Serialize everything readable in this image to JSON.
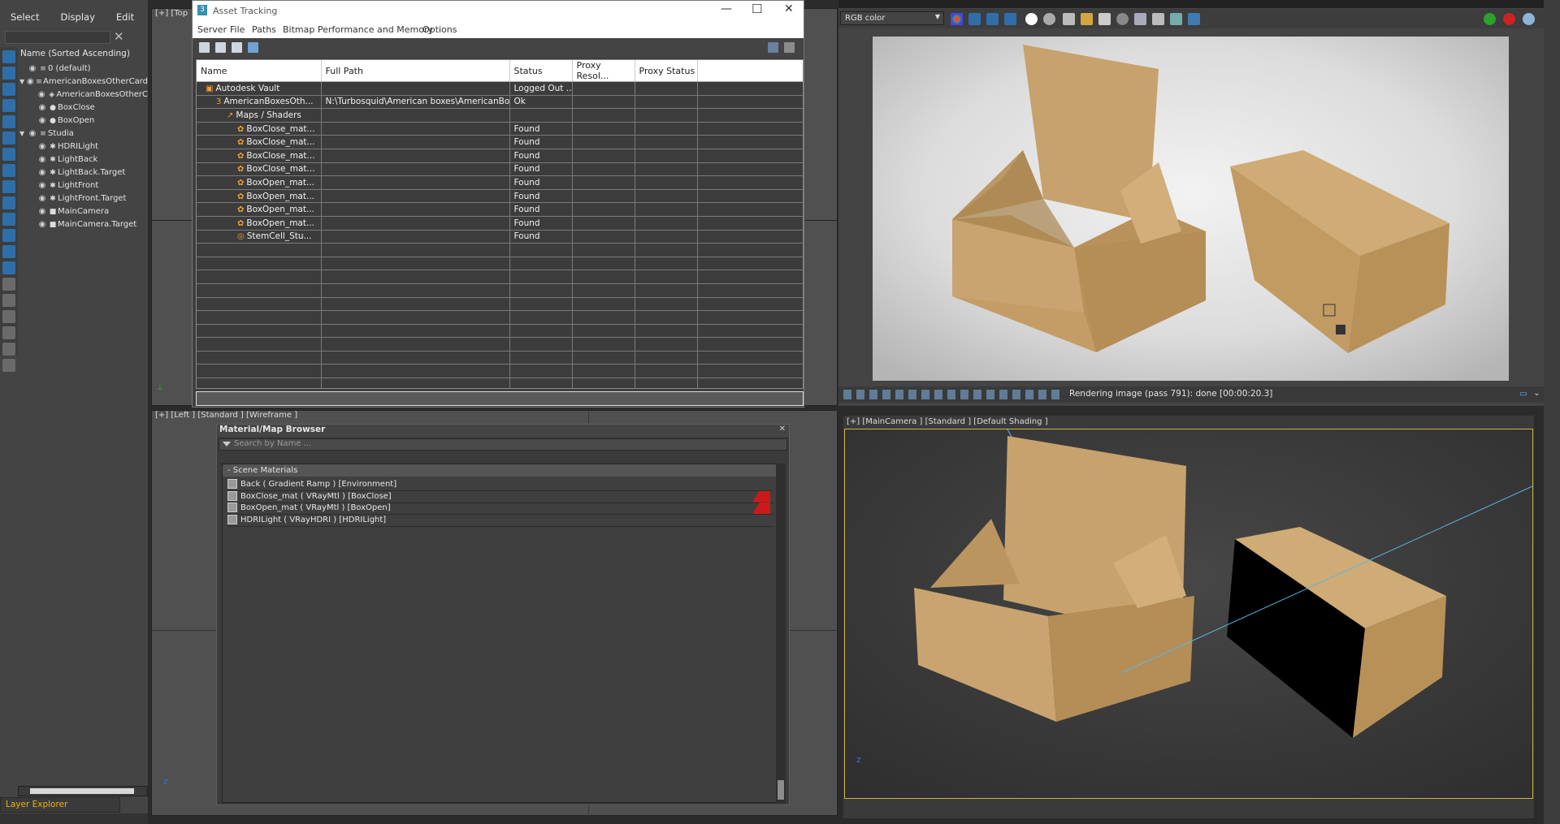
{
  "explorer": {
    "menu": [
      "Select",
      "Display",
      "Edit"
    ],
    "header": "Name (Sorted Ascending)",
    "rows": [
      {
        "indent": 0,
        "twisty": "",
        "label": "0 (default)",
        "icon": "layer"
      },
      {
        "indent": 0,
        "twisty": "▼",
        "label": "AmericanBoxesOtherCard",
        "icon": "layer"
      },
      {
        "indent": 1,
        "twisty": "",
        "label": "AmericanBoxesOtherC",
        "icon": "container"
      },
      {
        "indent": 1,
        "twisty": "",
        "label": "BoxClose",
        "icon": "object"
      },
      {
        "indent": 1,
        "twisty": "",
        "label": "BoxOpen",
        "icon": "object"
      },
      {
        "indent": 0,
        "twisty": "▼",
        "label": "Studia",
        "icon": "layer"
      },
      {
        "indent": 1,
        "twisty": "",
        "label": "HDRILight",
        "icon": "light"
      },
      {
        "indent": 1,
        "twisty": "",
        "label": "LightBack",
        "icon": "light"
      },
      {
        "indent": 1,
        "twisty": "",
        "label": "LightBack.Target",
        "icon": "light"
      },
      {
        "indent": 1,
        "twisty": "",
        "label": "LightFront",
        "icon": "light"
      },
      {
        "indent": 1,
        "twisty": "",
        "label": "LightFront.Target",
        "icon": "light"
      },
      {
        "indent": 1,
        "twisty": "",
        "label": "MainCamera",
        "icon": "camera"
      },
      {
        "indent": 1,
        "twisty": "",
        "label": "MainCamera.Target",
        "icon": "camera"
      }
    ],
    "layer_explorer": "Layer Explorer"
  },
  "viewports": {
    "top_label": "[+] [Top",
    "left_label": "[+] [Left ] [Standard ] [Wireframe ]",
    "cam_label": "[+] [MainCamera ] [Standard ] [Default Shading ]"
  },
  "asset_tracking": {
    "title": "Asset Tracking",
    "menu": [
      "Server",
      "File",
      "Paths",
      "Bitmap Performance and Memory",
      "Options"
    ],
    "columns": [
      "Name",
      "Full Path",
      "Status",
      "Proxy Resol...",
      "Proxy Status"
    ],
    "rows": [
      {
        "indent": 1,
        "name": "Autodesk Vault",
        "path": "",
        "status": "Logged Out ...",
        "icon": "vault"
      },
      {
        "indent": 2,
        "name": "AmericanBoxesOth...",
        "path": "N:\\Turbosquid\\American boxes\\AmericanBo...",
        "status": "Ok",
        "icon": "max"
      },
      {
        "indent": 3,
        "name": "Maps / Shaders",
        "path": "",
        "status": "",
        "icon": "maps"
      },
      {
        "indent": 4,
        "name": "BoxClose_mat...",
        "path": "",
        "status": "Found",
        "icon": "mat"
      },
      {
        "indent": 4,
        "name": "BoxClose_mat...",
        "path": "",
        "status": "Found",
        "icon": "mat"
      },
      {
        "indent": 4,
        "name": "BoxClose_mat...",
        "path": "",
        "status": "Found",
        "icon": "mat"
      },
      {
        "indent": 4,
        "name": "BoxClose_mat...",
        "path": "",
        "status": "Found",
        "icon": "mat"
      },
      {
        "indent": 4,
        "name": "BoxOpen_mat...",
        "path": "",
        "status": "Found",
        "icon": "mat"
      },
      {
        "indent": 4,
        "name": "BoxOpen_mat...",
        "path": "",
        "status": "Found",
        "icon": "mat"
      },
      {
        "indent": 4,
        "name": "BoxOpen_mat...",
        "path": "",
        "status": "Found",
        "icon": "mat"
      },
      {
        "indent": 4,
        "name": "BoxOpen_mat...",
        "path": "",
        "status": "Found",
        "icon": "mat"
      },
      {
        "indent": 4,
        "name": "StemCell_Stu...",
        "path": "",
        "status": "Found",
        "icon": "stem"
      }
    ],
    "empty_rows": 11
  },
  "material_browser": {
    "title": "Material/Map Browser",
    "search_placeholder": "Search by Name ...",
    "category": "- Scene Materials",
    "items": [
      {
        "label": "Back  ( Gradient Ramp )  [Environment]",
        "flag": false
      },
      {
        "label": "BoxClose_mat  ( VRayMtl )  [BoxClose]",
        "flag": true
      },
      {
        "label": "BoxOpen_mat  ( VRayMtl )  [BoxOpen]",
        "flag": true
      },
      {
        "label": "HDRILight  ( VRayHDRI )  [HDRILight]",
        "flag": false
      }
    ]
  },
  "render_frame": {
    "channel": "RGB color",
    "status": "Rendering image (pass 791): done [00:00:20.3]"
  },
  "colors": {
    "accent_blue": "#2f6ea8",
    "cardboard": "#c9a470",
    "flag_red": "#cc1a1a",
    "layer_explorer_text": "#f0b400"
  }
}
